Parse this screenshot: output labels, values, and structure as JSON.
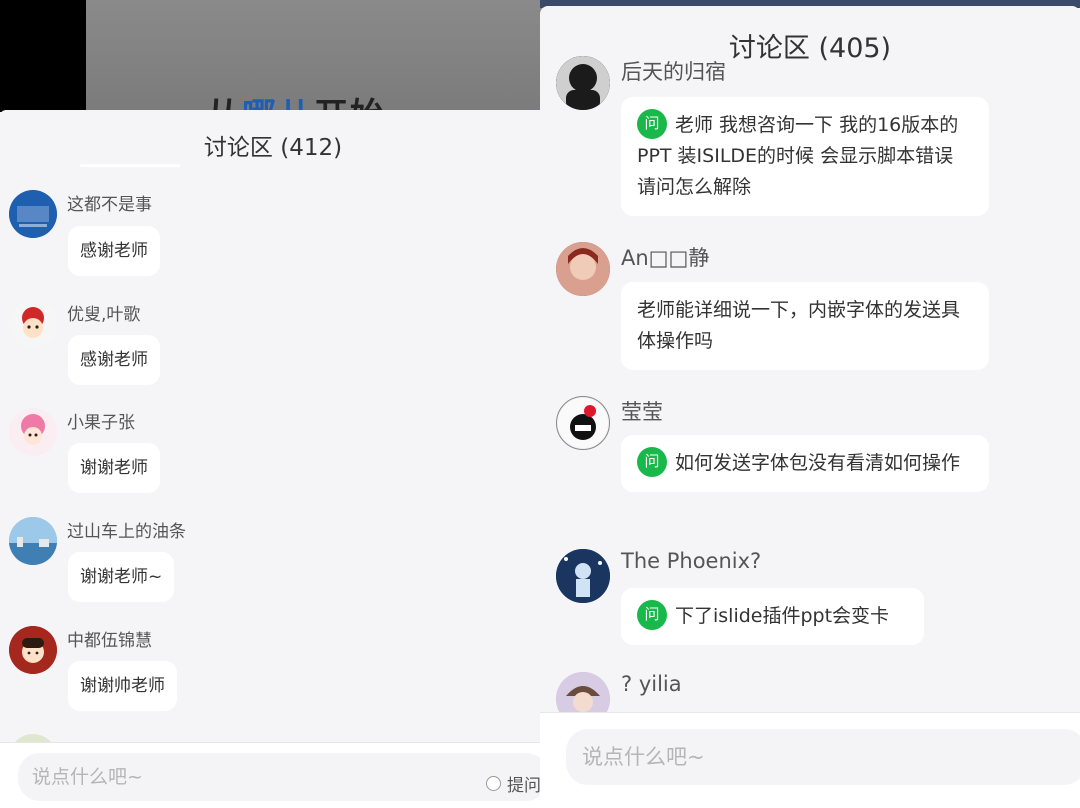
{
  "video": {
    "title_part1": "从",
    "title_highlight": "哪儿",
    "title_part2": "开始"
  },
  "left_panel": {
    "title": "讨论区 (412)",
    "messages": [
      {
        "user": "这都不是事",
        "text": "感谢老师",
        "avatar_color": "#1f5fb0"
      },
      {
        "user": "优叟,叶歌",
        "text": "感谢老师",
        "avatar_color": "#f6f6f6"
      },
      {
        "user": "小果子张",
        "text": "谢谢老师",
        "avatar_color": "#f7c8d8"
      },
      {
        "user": "过山车上的油条",
        "text": "谢谢老师~",
        "avatar_color": "#6aa6d6"
      },
      {
        "user": "中都伍锦慧",
        "text": "谢谢帅老师",
        "avatar_color": "#a4281e"
      },
      {
        "user": "",
        "text": "",
        "avatar_color": "#e0e6cf"
      }
    ],
    "input_placeholder": "说点什么吧~",
    "ask_label": "提问"
  },
  "right_panel": {
    "title": "讨论区 (405)",
    "messages": [
      {
        "user": "后天的归宿",
        "text": "老师 我想咨询一下 我的16版本的PPT 装ISILDE的时候 会显示脚本错误 请问怎么解除",
        "is_question": true,
        "avatar_color": "#1b1b1b"
      },
      {
        "user": "An□□静",
        "text": "老师能详细说一下，内嵌字体的发送具体操作吗",
        "is_question": false,
        "avatar_color": "#b65a4a"
      },
      {
        "user": "莹莹",
        "text": "如何发送字体包没有看清如何操作",
        "is_question": true,
        "avatar_color": "#f2f2f2"
      },
      {
        "user": "The Phoenix?",
        "text": "下了islide插件ppt会变卡",
        "is_question": true,
        "avatar_color": "#234a78"
      },
      {
        "user": "? yilia",
        "text": "",
        "is_question": false,
        "avatar_color": "#c9b8d8"
      }
    ],
    "question_badge": "问",
    "input_placeholder": "说点什么吧~"
  },
  "colors": {
    "question_badge": "#19b84a",
    "panel_bg": "#f5f5f7",
    "bubble_bg": "#ffffff"
  }
}
